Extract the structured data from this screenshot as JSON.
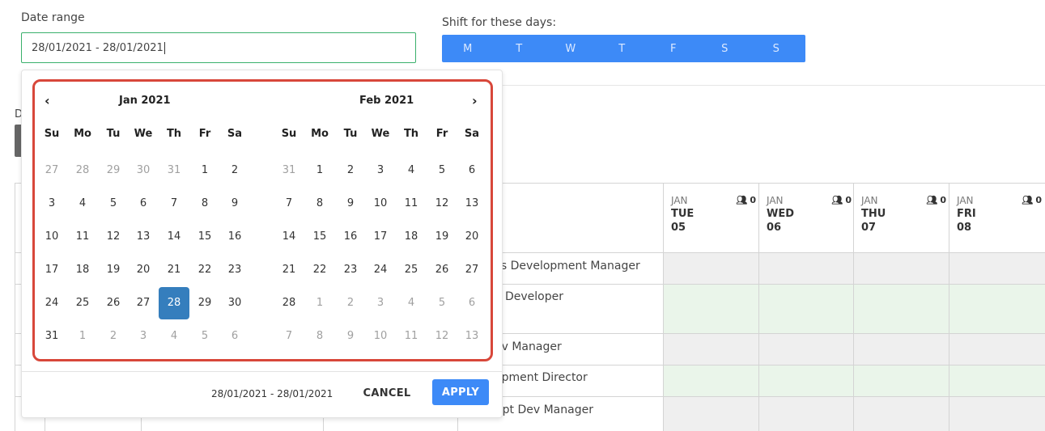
{
  "form": {
    "date_range_label": "Date range",
    "date_range_value": "28/01/2021 - 28/01/2021",
    "shift_label": "Shift for these days:",
    "shift_days": [
      "M",
      "T",
      "W",
      "T",
      "F",
      "S",
      "S"
    ],
    "accent_color": "#3d8af7"
  },
  "background_table": {
    "left_partial_label": "D",
    "days": [
      {
        "month": "JAN",
        "weekday": "TUE",
        "day": "05",
        "count": "0"
      },
      {
        "month": "JAN",
        "weekday": "WED",
        "day": "06",
        "count": "0"
      },
      {
        "month": "JAN",
        "weekday": "THU",
        "day": "07",
        "count": "0"
      },
      {
        "month": "JAN",
        "weekday": "FRI",
        "day": "08",
        "count": "0"
      }
    ],
    "rows": [
      "ess Development Manager",
      "Developer",
      "ev Manager",
      "opment Director",
      "ript Dev Manager"
    ]
  },
  "picker": {
    "prev_icon": "chevron-left-icon",
    "next_icon": "chevron-right-icon",
    "weekday_headers": [
      "Su",
      "Mo",
      "Tu",
      "We",
      "Th",
      "Fr",
      "Sa"
    ],
    "months": [
      {
        "title": "Jan 2021",
        "weeks": [
          [
            "27",
            "28",
            "29",
            "30",
            "31",
            "1",
            "2"
          ],
          [
            "3",
            "4",
            "5",
            "6",
            "7",
            "8",
            "9"
          ],
          [
            "10",
            "11",
            "12",
            "13",
            "14",
            "15",
            "16"
          ],
          [
            "17",
            "18",
            "19",
            "20",
            "21",
            "22",
            "23"
          ],
          [
            "24",
            "25",
            "26",
            "27",
            "28",
            "29",
            "30"
          ],
          [
            "31",
            "1",
            "2",
            "3",
            "4",
            "5",
            "6"
          ]
        ],
        "off_cells": [
          [
            0,
            0
          ],
          [
            0,
            1
          ],
          [
            0,
            2
          ],
          [
            0,
            3
          ],
          [
            0,
            4
          ],
          [
            5,
            1
          ],
          [
            5,
            2
          ],
          [
            5,
            3
          ],
          [
            5,
            4
          ],
          [
            5,
            5
          ],
          [
            5,
            6
          ]
        ],
        "selected_cell": [
          4,
          4
        ]
      },
      {
        "title": "Feb 2021",
        "weeks": [
          [
            "31",
            "1",
            "2",
            "3",
            "4",
            "5",
            "6"
          ],
          [
            "7",
            "8",
            "9",
            "10",
            "11",
            "12",
            "13"
          ],
          [
            "14",
            "15",
            "16",
            "17",
            "18",
            "19",
            "20"
          ],
          [
            "21",
            "22",
            "23",
            "24",
            "25",
            "26",
            "27"
          ],
          [
            "28",
            "1",
            "2",
            "3",
            "4",
            "5",
            "6"
          ],
          [
            "7",
            "8",
            "9",
            "10",
            "11",
            "12",
            "13"
          ]
        ],
        "off_cells": [
          [
            0,
            0
          ],
          [
            4,
            1
          ],
          [
            4,
            2
          ],
          [
            4,
            3
          ],
          [
            4,
            4
          ],
          [
            4,
            5
          ],
          [
            4,
            6
          ],
          [
            5,
            0
          ],
          [
            5,
            1
          ],
          [
            5,
            2
          ],
          [
            5,
            3
          ],
          [
            5,
            4
          ],
          [
            5,
            5
          ],
          [
            5,
            6
          ]
        ],
        "selected_cell": null
      }
    ],
    "footer_range": "28/01/2021 - 28/01/2021",
    "cancel_label": "CANCEL",
    "apply_label": "APPLY",
    "selected_color": "#357ebd",
    "highlight_frame_color": "#d8473a"
  }
}
